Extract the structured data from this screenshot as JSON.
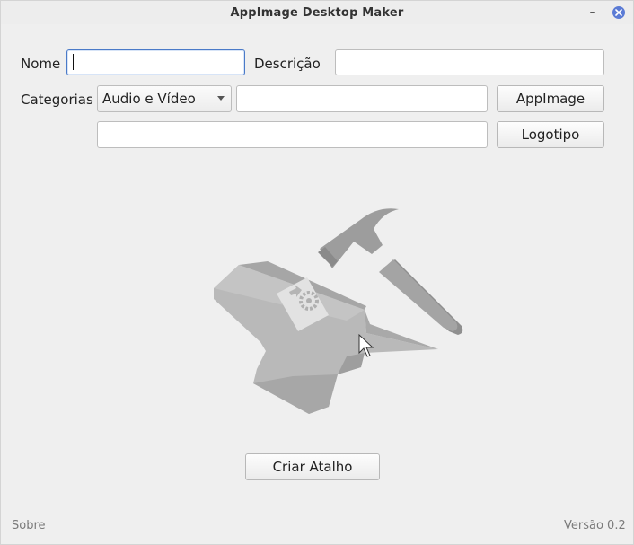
{
  "window": {
    "title": "AppImage Desktop Maker",
    "minimize_glyph": "–",
    "close_glyph": "×"
  },
  "form": {
    "name_label": "Nome",
    "name_value": "",
    "description_label": "Descrição",
    "description_value": "",
    "categories_label": "Categorias",
    "category_selected": "Audio e Vídeo",
    "appimage_path": "",
    "appimage_button": "AppImage",
    "logo_path": "",
    "logo_button": "Logotipo"
  },
  "actions": {
    "create_button": "Criar Atalho"
  },
  "footer": {
    "about_label": "Sobre",
    "version_label": "Versão 0.2"
  },
  "illustration": {
    "icons": [
      "anvil-icon",
      "hammer-icon",
      "gear-icon",
      "mouse-cursor-icon"
    ],
    "color": "#b9b9b9"
  }
}
